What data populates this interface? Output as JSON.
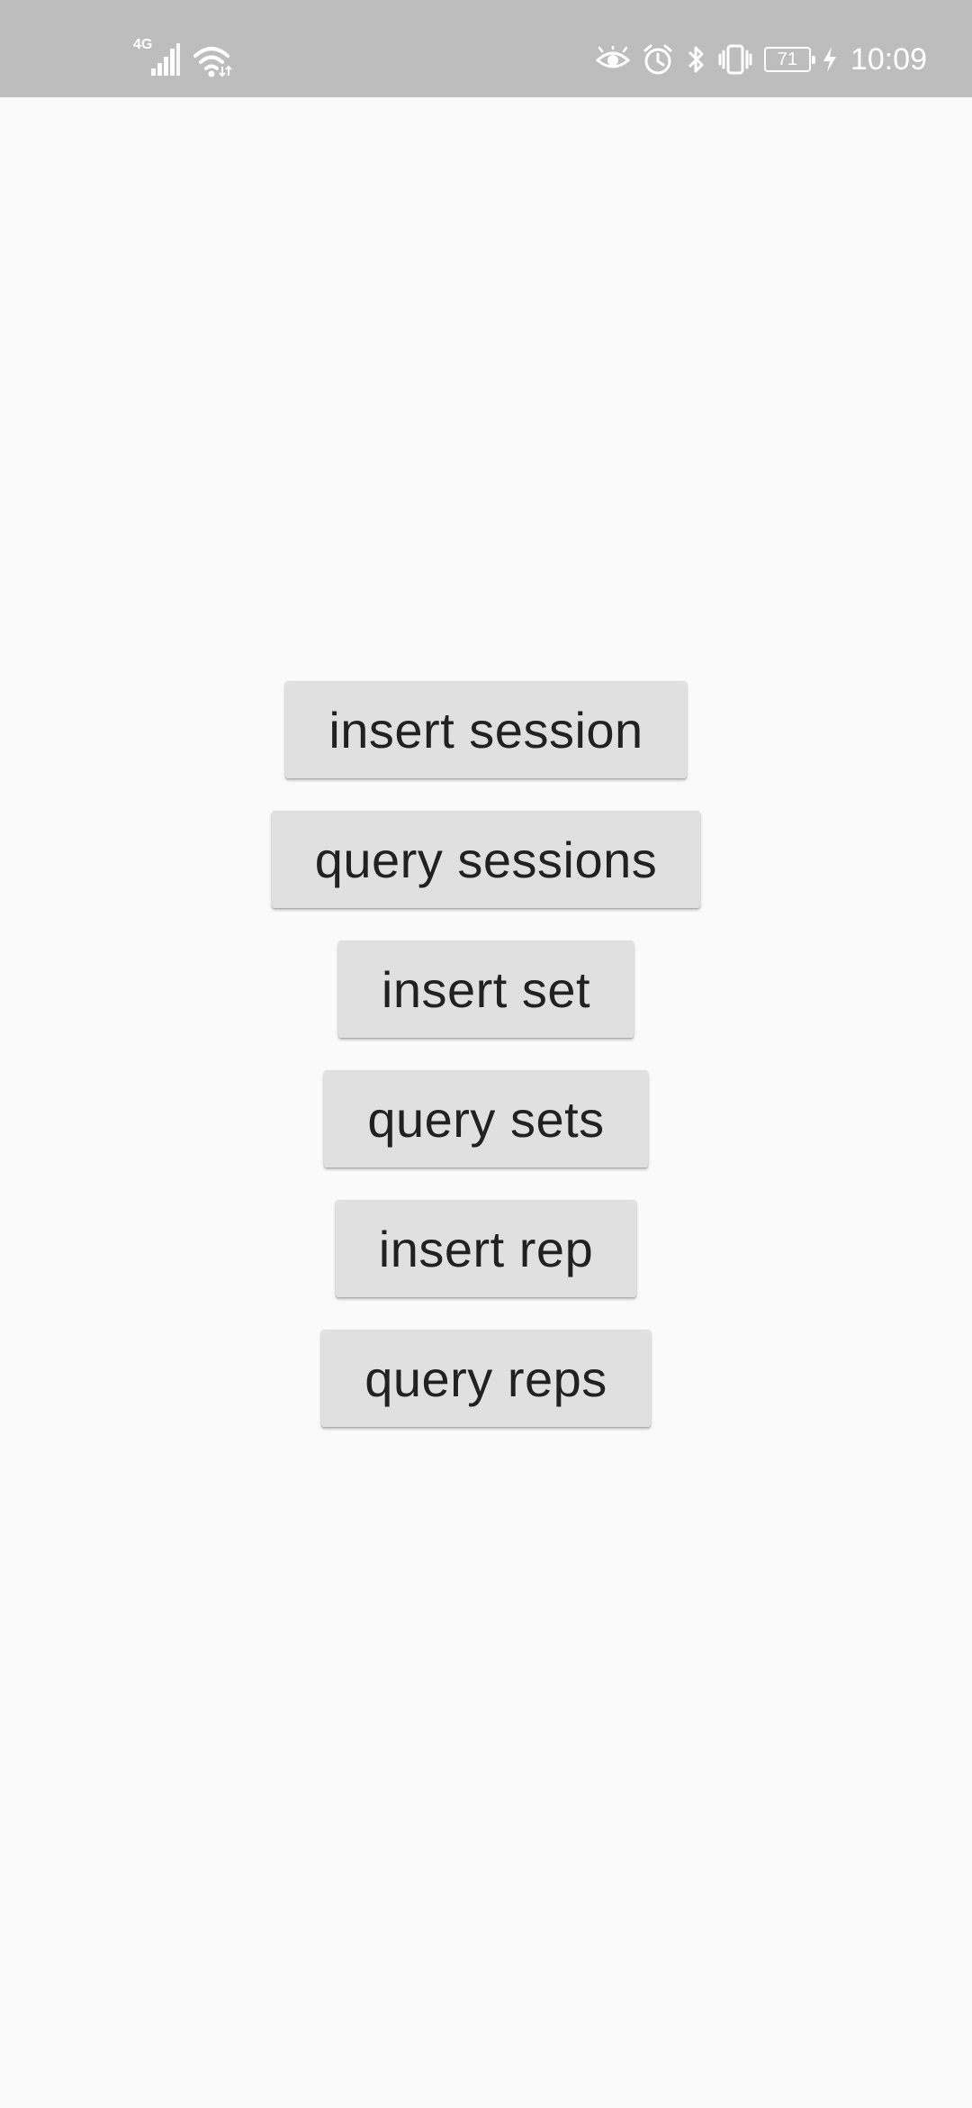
{
  "status_bar": {
    "network_type": "4G",
    "signal_icon": "cell-signal-icon",
    "wifi_icon": "wifi-icon",
    "eye_icon": "eye-comfort-icon",
    "alarm_icon": "alarm-icon",
    "bluetooth_icon": "bluetooth-icon",
    "vibrate_icon": "vibrate-icon",
    "battery_level": "71",
    "charging_icon": "charging-bolt-icon",
    "time": "10:09",
    "background_color": "#bdbdbd"
  },
  "main": {
    "background_color": "#fafafa",
    "button_color": "#e0e0e0",
    "buttons": [
      {
        "label": "insert session"
      },
      {
        "label": "query sessions"
      },
      {
        "label": "insert set"
      },
      {
        "label": "query sets"
      },
      {
        "label": "insert rep"
      },
      {
        "label": "query reps"
      }
    ]
  }
}
